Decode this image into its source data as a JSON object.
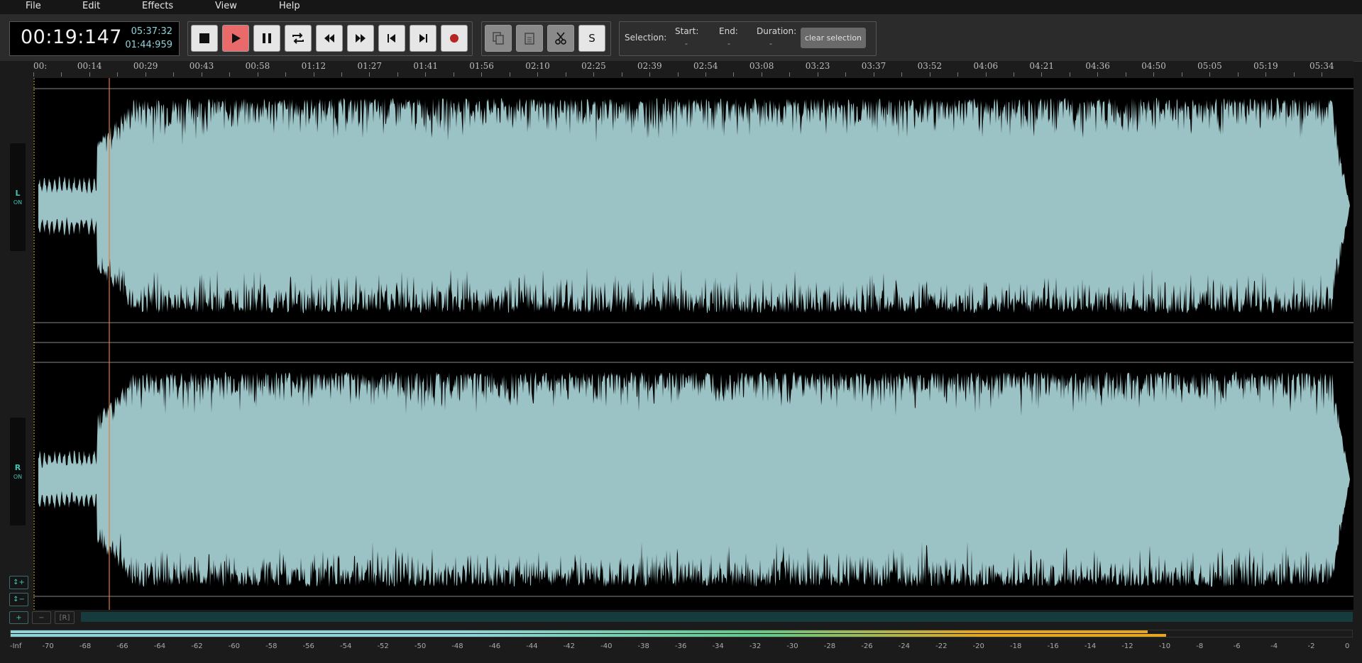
{
  "menu": [
    "File",
    "Edit",
    "Effects",
    "View",
    "Help"
  ],
  "time": {
    "current": "00:19:147",
    "total": "05:37:32",
    "selection": "01:44:959"
  },
  "transport": {
    "stop": "stop-icon",
    "play": "play-icon",
    "pause": "pause-icon",
    "loop": "loop-icon",
    "rewind": "rewind-icon",
    "fast_forward": "fast-forward-icon",
    "skip_start": "skip-back-icon",
    "skip_end": "skip-forward-icon",
    "record": "record-icon"
  },
  "edit_tools": {
    "copy": "copy-icon",
    "paste": "paste-icon",
    "cut": "scissors-icon",
    "silence_label": "S"
  },
  "selection": {
    "label": "Selection:",
    "start_label": "Start:",
    "start_value": "-",
    "end_label": "End:",
    "end_value": "-",
    "duration_label": "Duration:",
    "duration_value": "-",
    "clear_label": "clear selection"
  },
  "timeline": [
    "00:",
    "00:14",
    "00:29",
    "00:43",
    "00:58",
    "01:12",
    "01:27",
    "01:41",
    "01:56",
    "02:10",
    "02:25",
    "02:39",
    "02:54",
    "03:08",
    "03:23",
    "03:37",
    "03:52",
    "04:06",
    "04:21",
    "04:36",
    "04:50",
    "05:05",
    "05:19",
    "05:34"
  ],
  "channels": [
    {
      "name": "L",
      "state": "ON"
    },
    {
      "name": "R",
      "state": "ON"
    }
  ],
  "zoom": {
    "v_in": "↕+",
    "v_out": "↕−",
    "h_in": "+",
    "h_out": "−",
    "reset": "[R]"
  },
  "meter": {
    "labels": [
      "-Inf",
      "-70",
      "-68",
      "-66",
      "-64",
      "-62",
      "-60",
      "-58",
      "-56",
      "-54",
      "-52",
      "-50",
      "-48",
      "-46",
      "-44",
      "-42",
      "-40",
      "-38",
      "-36",
      "-34",
      "-32",
      "-30",
      "-28",
      "-26",
      "-24",
      "-22",
      "-20",
      "-18",
      "-16",
      "-14",
      "-12",
      "-10",
      "-8",
      "-6",
      "-4",
      "-2",
      "0"
    ],
    "level_left_db": -11,
    "level_right_db": -10,
    "colors": {
      "low": "#8ed4d9",
      "mid": "#62c98a",
      "high": "#e6a51f"
    }
  },
  "colors": {
    "waveform": "#9bc2c5",
    "playhead": "#e07a3c",
    "accent": "#45c2b1"
  }
}
